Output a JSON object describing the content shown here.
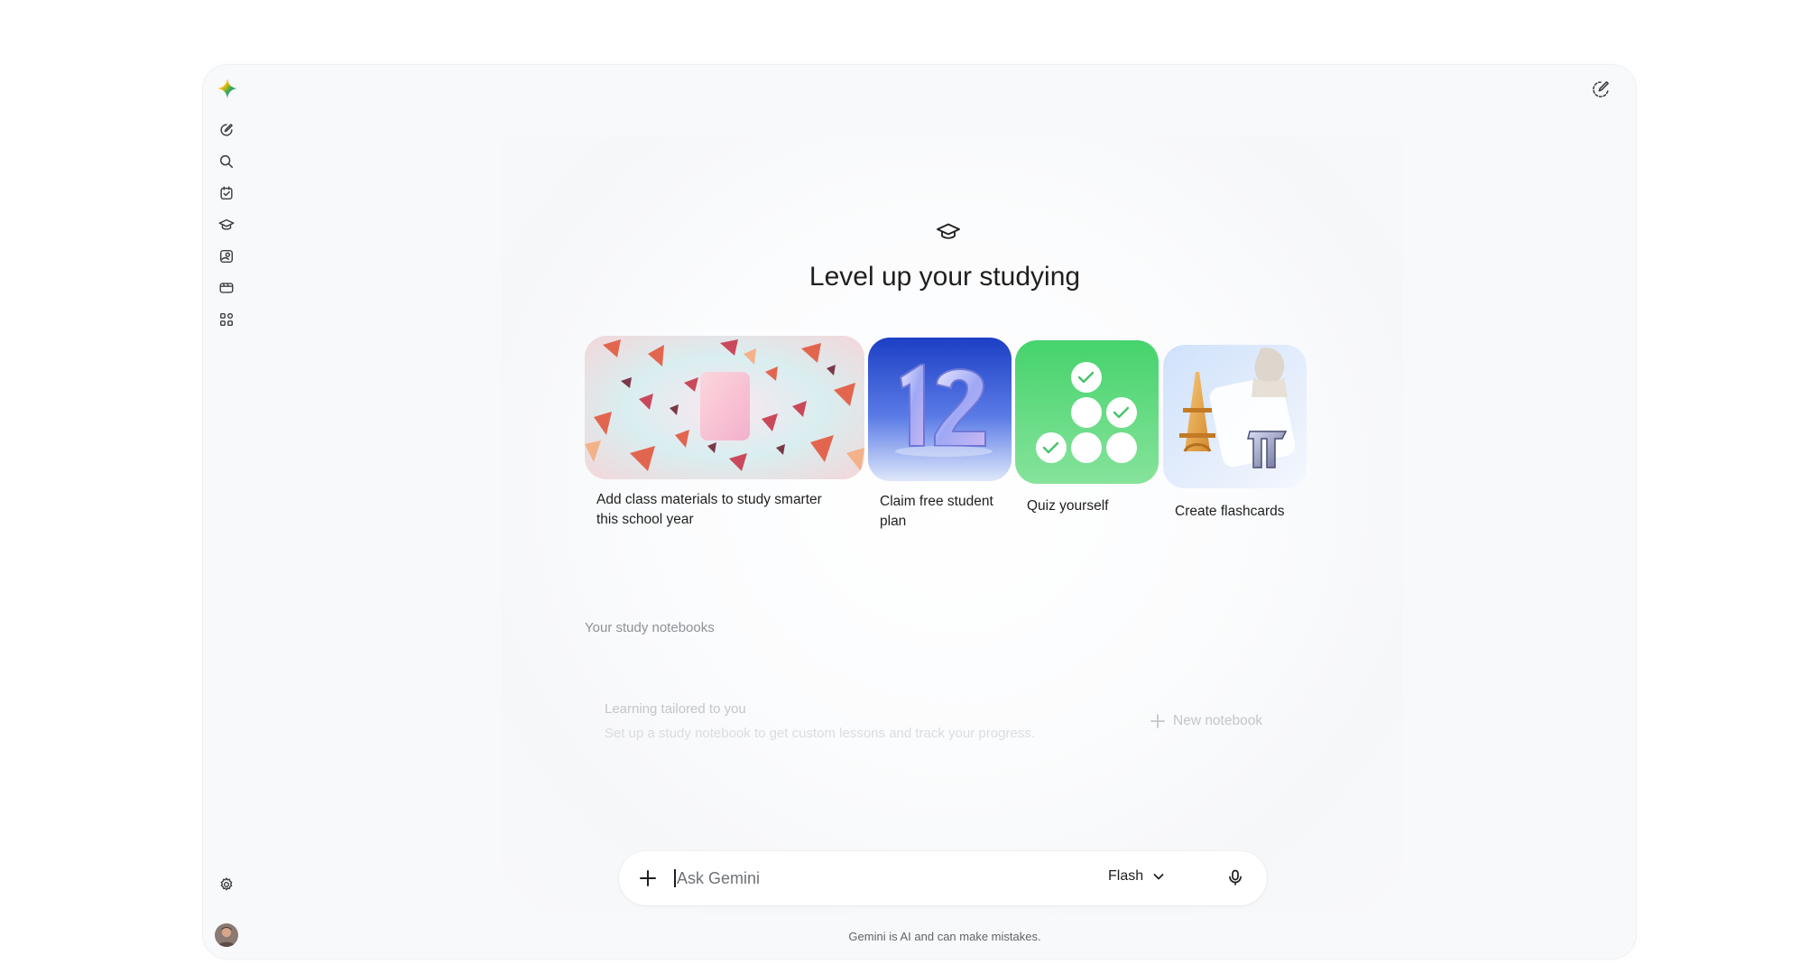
{
  "colors": {
    "accent": "#4285f4",
    "text": "#1f1f1f",
    "muted": "#8e9196",
    "faint": "#c3c6ca"
  },
  "sidebar": {
    "items": [
      {
        "icon": "new-chat-icon"
      },
      {
        "icon": "search-icon"
      },
      {
        "icon": "tasks-icon"
      },
      {
        "icon": "learning-icon"
      },
      {
        "icon": "gallery-icon"
      },
      {
        "icon": "video-icon"
      },
      {
        "icon": "apps-icon"
      }
    ],
    "bottom": [
      {
        "icon": "settings-icon"
      },
      {
        "icon": "avatar"
      }
    ]
  },
  "header": {
    "title": "Level up your studying"
  },
  "cards": [
    {
      "label": "Add class materials to study smarter this school year"
    },
    {
      "label": "Claim free student plan"
    },
    {
      "label": "Quiz yourself"
    },
    {
      "label": "Create flashcards"
    }
  ],
  "notebooks": {
    "title": "Your study notebooks",
    "empty_title": "Learning tailored to you",
    "empty_subtitle": "Set up a study notebook to get custom lessons and track your progress.",
    "new_label": "New notebook"
  },
  "prompt": {
    "placeholder": "Ask Gemini",
    "model": "Flash"
  },
  "footer": {
    "disclaimer": "Gemini is AI and can make mistakes."
  }
}
